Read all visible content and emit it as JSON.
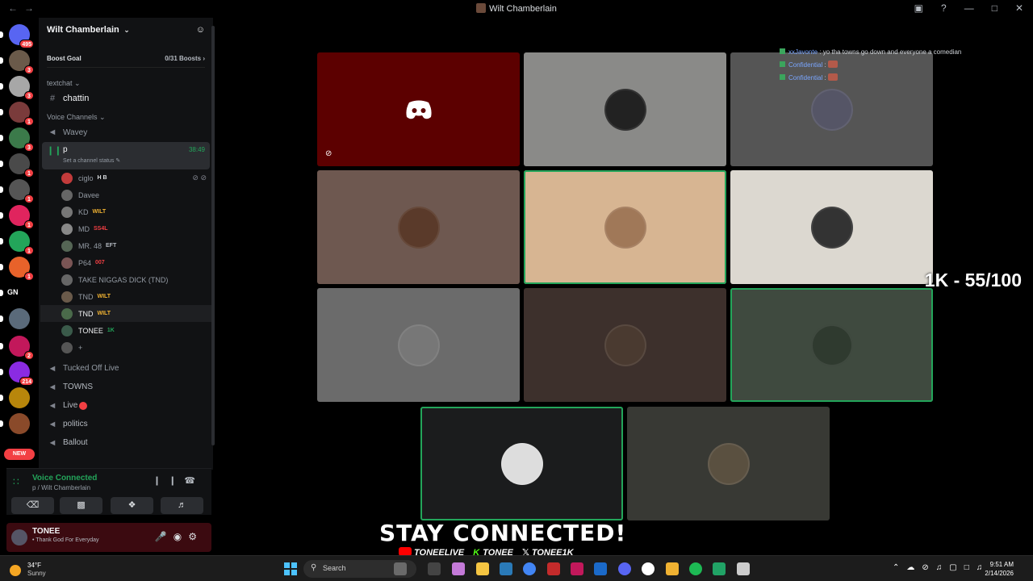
{
  "window": {
    "title": "Wilt Chamberlain"
  },
  "server_rail": {
    "badges": [
      "495",
      "3",
      "3",
      "1",
      "3",
      "1",
      "1",
      "1",
      "1",
      "1",
      "",
      "",
      "2",
      "214",
      "",
      ""
    ],
    "labels": {
      "gn": "GN",
      "new": "NEW"
    }
  },
  "sidebar": {
    "server_name": "Wilt Chamberlain",
    "boost_goal": "Boost Goal",
    "boost_count": "0/31 Boosts",
    "text_category": "textchat",
    "text_channel": "chattin",
    "voice_category": "Voice Channels",
    "channels_top": [
      "Wavey"
    ],
    "active_channel": {
      "name": "p",
      "timer": "38:49",
      "status": "Set a channel status"
    },
    "voice_users": [
      {
        "name": "ciglo",
        "tag": "H B"
      },
      {
        "name": "Davee",
        "tag": ""
      },
      {
        "name": "KD",
        "tag": "WILT"
      },
      {
        "name": "MD",
        "tag": "SS4L"
      },
      {
        "name": "MR. 48",
        "tag": "EFT"
      },
      {
        "name": "P64",
        "tag": "007"
      },
      {
        "name": "TAKE NIGGAS DICK (TND)",
        "tag": ""
      },
      {
        "name": "TND",
        "tag": "WILT"
      },
      {
        "name": "TND",
        "tag": "WILT"
      },
      {
        "name": "TONEE",
        "tag": "1K"
      },
      {
        "name": "+",
        "tag": ""
      }
    ],
    "channels_bottom": [
      "Tucked Off Live",
      "TOWNS",
      "Live",
      "politics",
      "Ballout"
    ]
  },
  "voice_panel": {
    "status": "Voice Connected",
    "location": "p / Wilt Chamberlain"
  },
  "user_bar": {
    "name": "TONEE",
    "status": "Thank God For Everyday"
  },
  "chat_overlay": [
    {
      "name": "xxJavonte",
      "message": ": yo tha towns go down and everyone a comedian"
    },
    {
      "name": "Confidential",
      "message": ":"
    },
    {
      "name": "Confidential",
      "message": ":"
    }
  ],
  "video_tiles": [
    {
      "bg": "#5c0000",
      "discord": true
    },
    {
      "bg": "#8a8a88"
    },
    {
      "bg": "#555555"
    },
    {
      "bg": "#6e5850"
    },
    {
      "bg": "#d7b592",
      "speaking": true
    },
    {
      "bg": "#dcd8d0"
    },
    {
      "bg": "#6b6b6b"
    },
    {
      "bg": "#3d302c"
    },
    {
      "bg": "#3f4a3f",
      "speaking": true
    },
    {
      "bg": "#1b1c1d",
      "speaking": true
    },
    {
      "bg": "#383934"
    }
  ],
  "overlay": {
    "counter": "1K - 55/100",
    "banner": "STAY CONNECTED!",
    "socials": [
      "TONEELIVE",
      "TONEE",
      "TONEE1K"
    ]
  },
  "taskbar": {
    "temperature": "34°F",
    "condition": "Sunny",
    "search_placeholder": "Search",
    "time": "9:51 AM",
    "date": "2/14/2026"
  },
  "colors": {
    "accent_green": "#23a55a",
    "badge_red": "#f23f43",
    "sidebar_bg": "#111214"
  }
}
